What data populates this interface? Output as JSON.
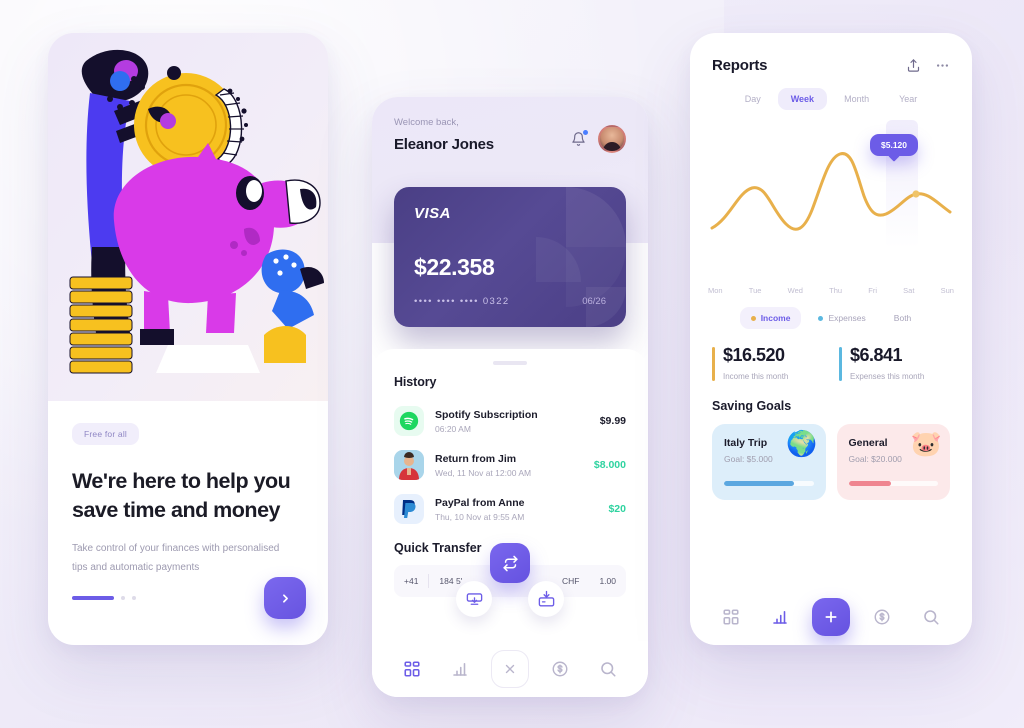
{
  "theme": {
    "accent": "#6c5ce7",
    "background": "#f4f1fa",
    "income_color": "#e8b04b",
    "expense_color": "#5bb8e0",
    "positive_color": "#2fd3a0"
  },
  "onboarding": {
    "badge": "Free for all",
    "title": "We're here to help you save time and money",
    "subtitle": "Take control of your finances with personalised tips and automatic payments",
    "next_icon": "chevron-right-icon",
    "pagination": {
      "active_index": 0,
      "total": 3
    },
    "illustration_name": "piggy-bank-illustration"
  },
  "home": {
    "welcome": "Welcome back,",
    "user_name": "Eleanor Jones",
    "bell_icon": "bell-icon",
    "avatar_name": "user-avatar",
    "card": {
      "brand": "VISA",
      "balance": "$22.358",
      "number": "•••• •••• •••• 0322",
      "expiry": "06/26"
    },
    "history": {
      "title": "History",
      "items": [
        {
          "name": "Spotify Subscription",
          "time": "06:20 AM",
          "amount": "$9.99",
          "positive": false,
          "icon": "spotify-icon"
        },
        {
          "name": "Return from Jim",
          "time": "Wed, 11 Nov at 12:00 AM",
          "amount": "$8.000",
          "positive": true,
          "icon": "person-avatar-icon"
        },
        {
          "name": "PayPal from Anne",
          "time": "Thu, 10 Nov at 9:55 AM",
          "amount": "$20",
          "positive": true,
          "icon": "paypal-icon"
        }
      ]
    },
    "quick_transfer": {
      "title": "Quick Transfer",
      "country_code": "+41",
      "phone": "184 5'",
      "currency": "CHF",
      "amount": "1.00",
      "swap_icon": "swap-arrows-icon",
      "withdraw_icon": "atm-withdraw-icon",
      "deposit_icon": "deposit-box-icon"
    },
    "bottom_nav": [
      {
        "icon": "grid-icon",
        "active": true
      },
      {
        "icon": "bar-chart-icon",
        "active": false
      },
      {
        "icon": "close-icon",
        "active": false
      },
      {
        "icon": "dollar-circle-icon",
        "active": false
      },
      {
        "icon": "search-icon",
        "active": false
      }
    ]
  },
  "reports": {
    "title": "Reports",
    "share_icon": "share-icon",
    "more_icon": "more-horizontal-icon",
    "range_tabs": [
      {
        "label": "Day",
        "active": false
      },
      {
        "label": "Week",
        "active": true
      },
      {
        "label": "Month",
        "active": false
      },
      {
        "label": "Year",
        "active": false
      }
    ],
    "tooltip_value": "$5.120",
    "legend": [
      {
        "label": "Income",
        "active": true,
        "color": "#e8b04b"
      },
      {
        "label": "Expenses",
        "active": false,
        "color": "#5bb8e0"
      },
      {
        "label": "Both",
        "active": false,
        "color": ""
      }
    ],
    "stats": [
      {
        "value": "$16.520",
        "label": "Income this month",
        "color": "#e8b04b"
      },
      {
        "value": "$6.841",
        "label": "Expenses this month",
        "color": "#5bb8e0"
      }
    ],
    "goals_title": "Saving Goals",
    "goals": [
      {
        "name": "Italy Trip",
        "goal": "Goal: $5.000",
        "progress": 78,
        "bg": "#ddeefa",
        "fill": "#5ba7e0",
        "emoji": "🌍",
        "icon": "globe-icon"
      },
      {
        "name": "General",
        "goal": "Goal: $20.000",
        "progress": 48,
        "bg": "#fce9ea",
        "fill": "#ef8590",
        "emoji": "🐷",
        "icon": "piggy-bank-icon"
      }
    ],
    "bottom_nav": [
      {
        "icon": "grid-icon",
        "active": false
      },
      {
        "icon": "bar-chart-icon",
        "active": true
      },
      {
        "icon": "plus-icon",
        "active": false
      },
      {
        "icon": "dollar-circle-icon",
        "active": false
      },
      {
        "icon": "search-icon",
        "active": false
      }
    ]
  },
  "chart_data": {
    "type": "line",
    "title": "Weekly income",
    "categories": [
      "Mon",
      "Tue",
      "Wed",
      "Thu",
      "Fri",
      "Sat",
      "Sun"
    ],
    "series": [
      {
        "name": "Income",
        "color": "#e8b04b",
        "values": [
          2100,
          3800,
          1250,
          5400,
          2700,
          5120,
          3450
        ]
      }
    ],
    "xlabel": "",
    "ylabel": "",
    "ylim": [
      0,
      6000
    ],
    "grid": false,
    "legend_position": "bottom",
    "annotations": [
      {
        "x": "Sat",
        "y": 5120,
        "text": "$5.120"
      }
    ]
  }
}
